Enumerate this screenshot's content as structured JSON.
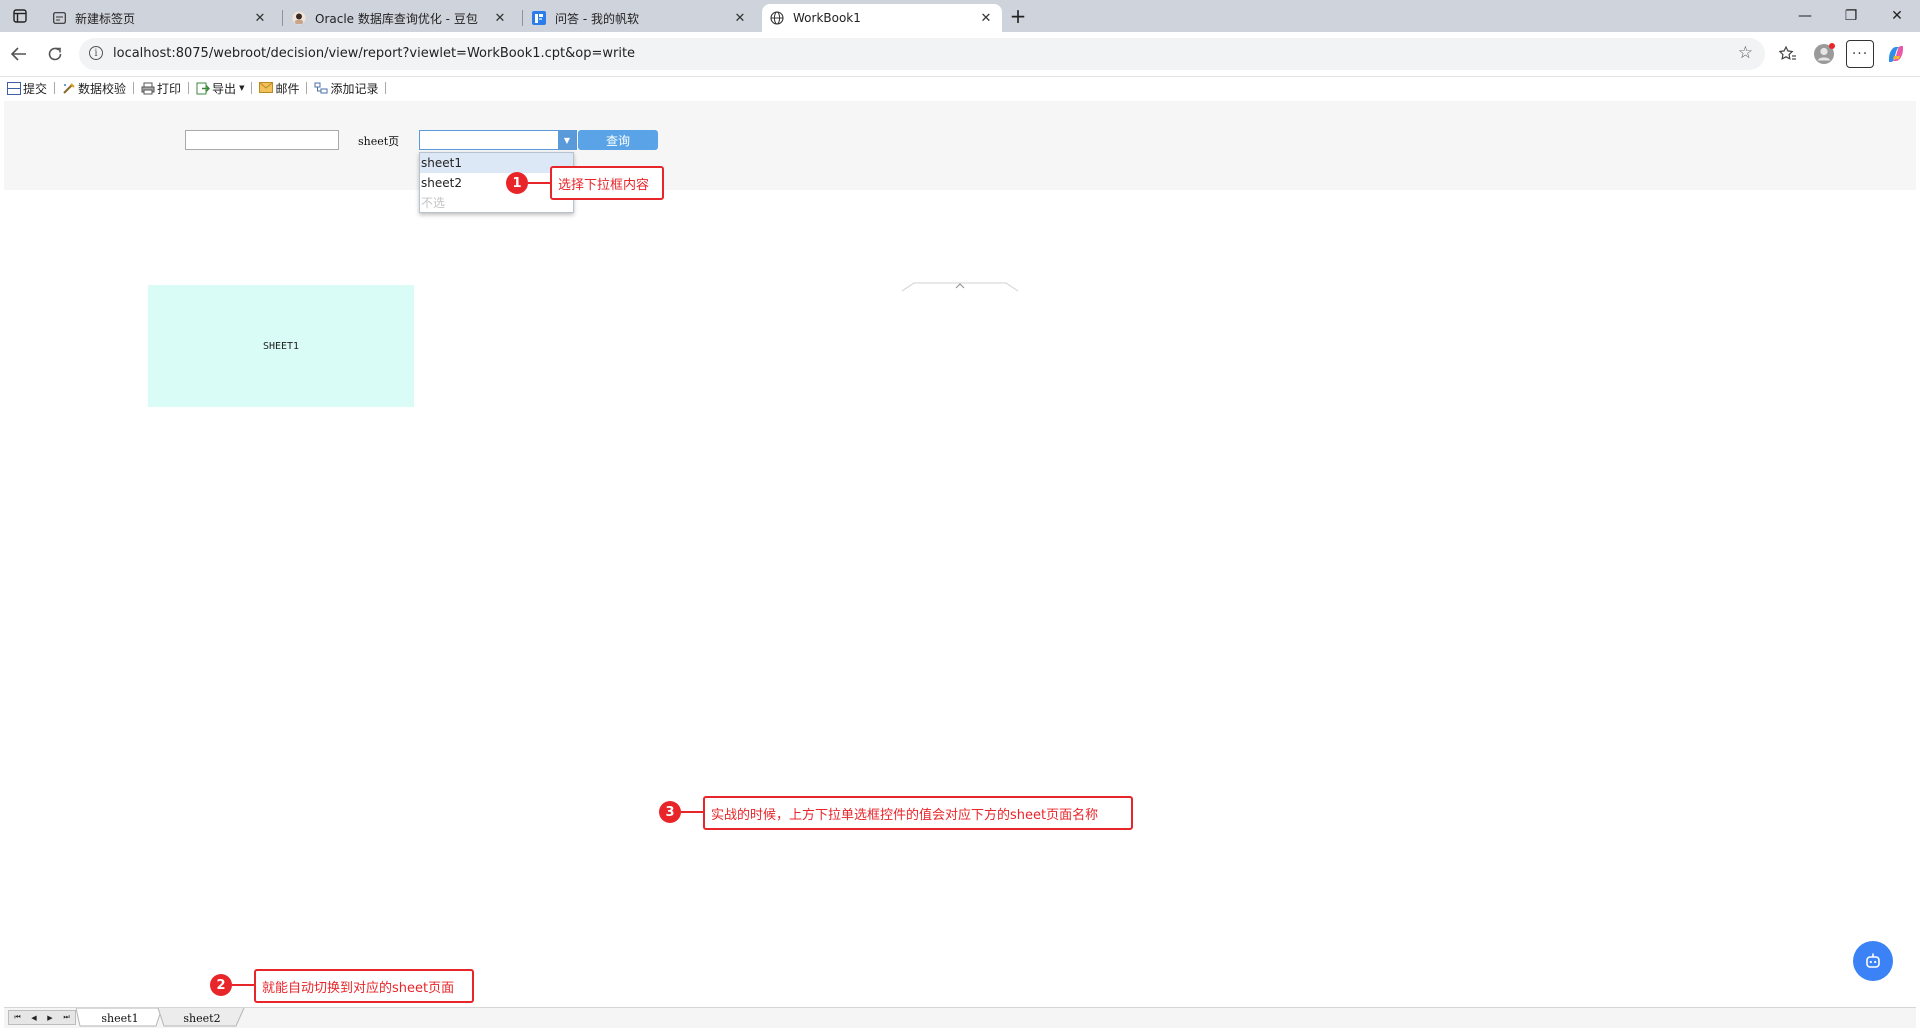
{
  "browser": {
    "tabs": [
      {
        "title": "新建标签页",
        "icon": "newtab-icon"
      },
      {
        "title": "Oracle 数据库查询优化 - 豆包",
        "icon": "doubao-avatar-icon"
      },
      {
        "title": "问答 - 我的帆软",
        "icon": "fanruan-icon"
      },
      {
        "title": "WorkBook1",
        "icon": "globe-icon",
        "active": true
      }
    ],
    "new_tab_glyph": "+",
    "close_glyph": "✕",
    "url": "localhost:8075/webroot/decision/view/report?viewlet=WorkBook1.cpt&op=write",
    "window": {
      "minimize": "—",
      "restore": "❐",
      "close": "✕"
    }
  },
  "report_toolbar": {
    "buttons": [
      {
        "label": "提交",
        "icon": "save-icon"
      },
      {
        "label": "数据校验",
        "icon": "verify-icon"
      },
      {
        "label": "打印",
        "icon": "printer-icon"
      },
      {
        "label": "导出",
        "icon": "export-icon",
        "dropdown": true
      },
      {
        "label": "邮件",
        "icon": "mail-icon"
      },
      {
        "label": "添加记录",
        "icon": "add-record-icon"
      }
    ]
  },
  "params": {
    "text_value": "",
    "sheet_label": "sheet页",
    "sheet_combo_value": "",
    "query_button": "查询"
  },
  "dropdown": {
    "options": [
      "sheet1",
      "sheet2",
      "不选"
    ],
    "highlighted": "sheet1"
  },
  "report": {
    "cell_text": "SHEET1"
  },
  "sheets": {
    "tabs": [
      "sheet1",
      "sheet2"
    ],
    "nav_glyphs": [
      "⏮",
      "◀",
      "▶",
      "⏭"
    ]
  },
  "annotations": [
    {
      "number": "1",
      "text": "选择下拉框内容"
    },
    {
      "number": "2",
      "text": "就能自动切换到对应的sheet页面"
    },
    {
      "number": "3",
      "text": "实战的时候，上方下拉单选框控件的值会对应下方的sheet页面名称"
    }
  ],
  "colors": {
    "annotation": "#e8262a",
    "query_button": "#5aa3e6",
    "cell_bg": "#dafcf6",
    "fab": "#3a82f6"
  }
}
